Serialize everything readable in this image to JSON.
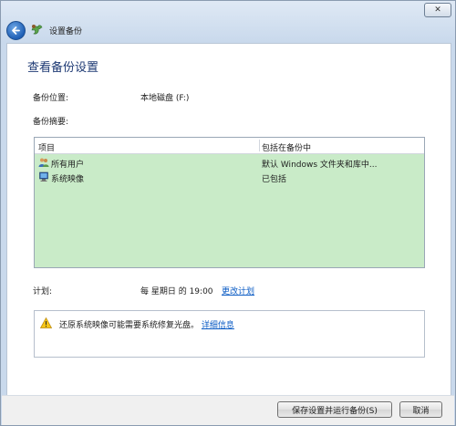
{
  "window": {
    "close_symbol": "✕",
    "title": "设置备份"
  },
  "page": {
    "title": "查看备份设置"
  },
  "backup_location": {
    "label": "备份位置:",
    "value": "本地磁盘 (F:)"
  },
  "summary": {
    "label": "备份摘要:",
    "columns": [
      "项目",
      "包括在备份中"
    ],
    "rows": [
      {
        "name": "所有用户",
        "value": "默认 Windows 文件夹和库中...",
        "icon": "users-icon"
      },
      {
        "name": "系统映像",
        "value": "已包括",
        "icon": "system-image-icon"
      }
    ]
  },
  "schedule": {
    "label": "计划:",
    "value": "每 星期日 的 19:00",
    "change_link": "更改计划"
  },
  "warning": {
    "text": "还原系统映像可能需要系统修复光盘。",
    "details_link": "详细信息"
  },
  "buttons": {
    "save_run": "保存设置并运行备份(S)",
    "cancel": "取消"
  },
  "colors": {
    "table_background": "#c9ebc8",
    "title_color": "#1e3a74",
    "link_color": "#0a5bc4"
  }
}
